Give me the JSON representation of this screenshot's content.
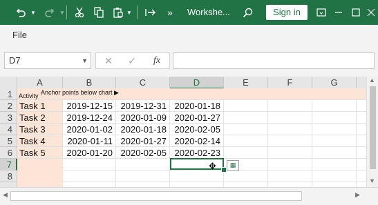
{
  "title_bar": {
    "doc_title": "Workshe...",
    "sign_in_label": "Sign in",
    "icons": [
      "undo-icon",
      "undo-dropdown-icon",
      "redo-icon",
      "redo-dropdown-icon",
      "cut-icon",
      "copy-icon",
      "paste-icon",
      "paste-dropdown-icon",
      "format-painter-icon",
      "more-commands-icon",
      "search-icon",
      "ribbon-display-icon",
      "minimize-icon",
      "maximize-icon",
      "close-icon"
    ],
    "more_commands_glyph": "»",
    "brand_color": "#217346"
  },
  "menu": {
    "file_label": "File"
  },
  "formula_bar": {
    "name_box_value": "D7",
    "fx_label": "fx",
    "formula_value": ""
  },
  "sheet": {
    "columns": [
      "A",
      "B",
      "C",
      "D",
      "E",
      "F",
      "G"
    ],
    "active_column": "D",
    "rows": [
      "1",
      "2",
      "3",
      "4",
      "5",
      "6",
      "7",
      "8"
    ],
    "active_row": "7",
    "header_row": {
      "a1": "Activity",
      "b1": "Anchor points below chart ▶"
    },
    "data": [
      {
        "task": "Task 1",
        "start": "2019-12-15",
        "mid": "2019-12-31",
        "end": "2020-01-18"
      },
      {
        "task": "Task 2",
        "start": "2019-12-24",
        "mid": "2020-01-09",
        "end": "2020-01-27"
      },
      {
        "task": "Task 3",
        "start": "2020-01-02",
        "mid": "2020-01-18",
        "end": "2020-02-05"
      },
      {
        "task": "Task 4",
        "start": "2020-01-11",
        "mid": "2020-01-27",
        "end": "2020-02-14"
      },
      {
        "task": "Task 5",
        "start": "2020-01-20",
        "mid": "2020-02-05",
        "end": "2020-02-23"
      }
    ],
    "selected_cell": "D7",
    "highlight_color": "#fce4d6"
  }
}
